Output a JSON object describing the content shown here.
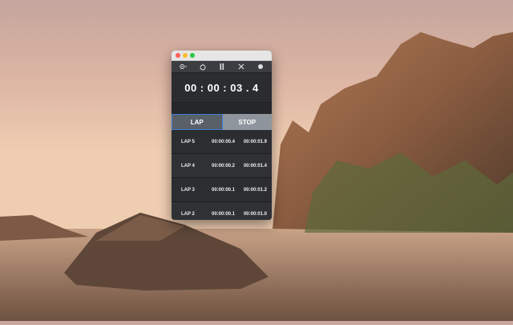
{
  "window": {
    "toolbar_icons": [
      "gear-dropdown-icon",
      "stopwatch-icon",
      "pause-icon",
      "shuffle-icon",
      "record-icon"
    ]
  },
  "timer": {
    "display": "00 : 00 : 03 . 4"
  },
  "buttons": {
    "lap_label": "LAP",
    "stop_label": "STOP"
  },
  "laps": [
    {
      "name": "LAP 5",
      "split": "00:00:00.4",
      "total": "00:00:01.9"
    },
    {
      "name": "LAP 4",
      "split": "00:00:00.2",
      "total": "00:00:01.4"
    },
    {
      "name": "LAP 3",
      "split": "00:00:00.1",
      "total": "00:00:01.2"
    },
    {
      "name": "LAP 2",
      "split": "00:00:00.1",
      "total": "00:00:01.0"
    }
  ],
  "colors": {
    "accent": "#3a7bd5",
    "window_bg": "#2b2d30"
  }
}
